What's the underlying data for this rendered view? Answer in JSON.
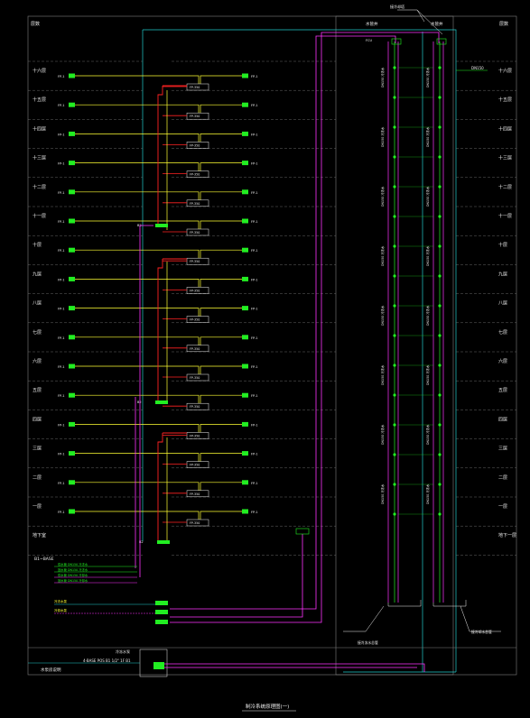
{
  "drawing": {
    "title": "制冷系统原理图(一)",
    "corner_left_top": "层数",
    "corner_right_top": "层数",
    "shaft_left_label": "水管井",
    "shaft_right_label": "水管井",
    "leader_top_label": "接冷却塔",
    "right_tag": "DN150",
    "bottom_left_label": "水泵房说明",
    "basement_note": "B1~BASE",
    "bottom_right_note_1": "接冷冻水总管",
    "bottom_right_note_2": "接冷却水总管",
    "basement_pipe_note": "4-BASE POS B1 1/2\" 1F B1",
    "pump_note": "冷冻水泵"
  },
  "floors": [
    "十六层",
    "十五层",
    "十四层",
    "十三层",
    "十二层",
    "十一层",
    "十层",
    "九层",
    "八层",
    "七层",
    "六层",
    "五层",
    "四层",
    "三层",
    "二层",
    "一层",
    "地下室"
  ],
  "floor_tags_right": [
    "十六层",
    "十五层",
    "十四层",
    "十三层",
    "十二层",
    "十一层",
    "十层",
    "九层",
    "八层",
    "七层",
    "六层",
    "五层",
    "四层",
    "三层",
    "二层",
    "一层",
    "地下一层"
  ],
  "unit_label": "FP-1",
  "riser_label": "FP-350",
  "valve_label": "FCU",
  "shaft_pipe_label": "DN150 冷冻水",
  "legend": [
    "供水管 DN150 冷冻水",
    "回水管 DN150 冷冻水",
    "供水管 DN150 冷却水",
    "回水管 DN150 冷却水"
  ],
  "pump_labels": [
    "冷冻水泵",
    "冷却水泵"
  ],
  "small_tags": [
    "B2",
    "B2"
  ],
  "colors": {
    "supply": "#ffff33",
    "return": "#ff2222",
    "cooling": "#ff33ff",
    "grid": "#7f7f7f",
    "cyan": "#22cccc",
    "green": "#22ee22",
    "white": "#eeeeee"
  }
}
